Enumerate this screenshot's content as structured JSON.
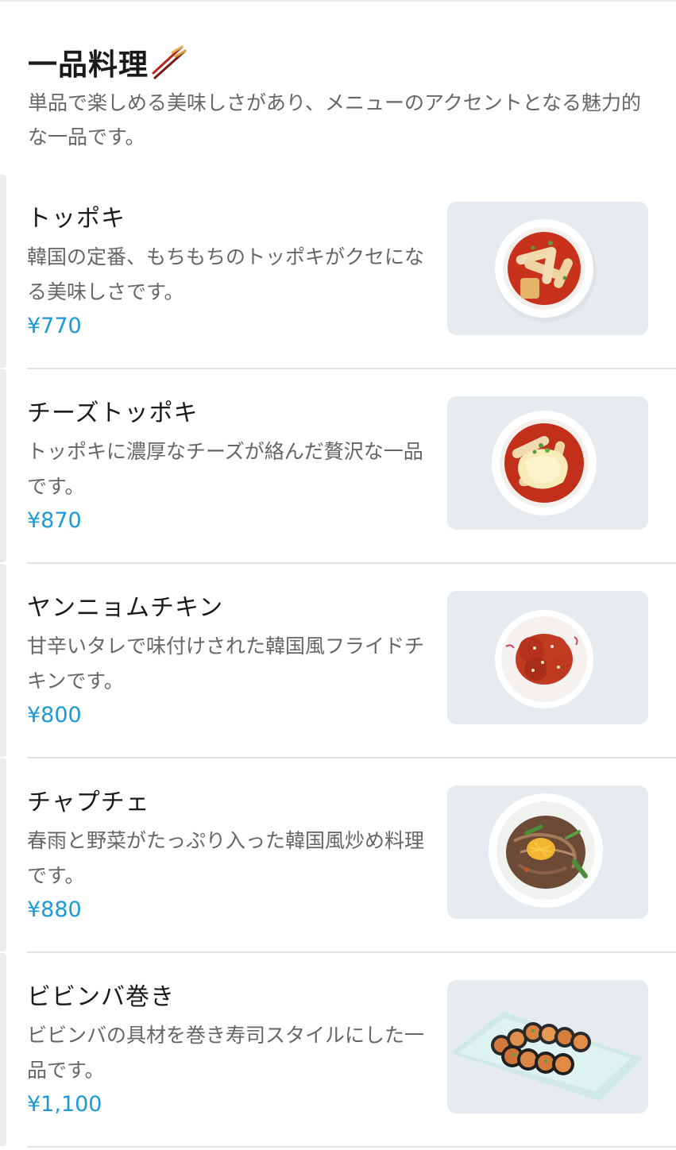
{
  "section": {
    "title": "一品料理",
    "description": "単品で楽しめる美味しさがあり、メニューのアクセントとなる魅力的な一品です。"
  },
  "colors": {
    "price": "#1a9ad6",
    "description": "#666666",
    "divider": "#e3e3e3"
  },
  "items": [
    {
      "name": "トッポキ",
      "description": "韓国の定番、もちもちのトッポキがクセになる美味しさです。",
      "price": "¥770",
      "image_icon": "tteokbokki-photo"
    },
    {
      "name": "チーズトッポキ",
      "description": "トッポキに濃厚なチーズが絡んだ贅沢な一品です。",
      "price": "¥870",
      "image_icon": "cheese-tteokbokki-photo"
    },
    {
      "name": "ヤンニョムチキン",
      "description": "甘辛いタレで味付けされた韓国風フライドチキンです。",
      "price": "¥800",
      "image_icon": "yangnyeom-chicken-photo"
    },
    {
      "name": "チャプチェ",
      "description": "春雨と野菜がたっぷり入った韓国風炒め料理です。",
      "price": "¥880",
      "image_icon": "japchae-photo"
    },
    {
      "name": "ビビンバ巻き",
      "description": "ビビンバの具材を巻き寿司スタイルにした一品です。",
      "price": "¥1,100",
      "image_icon": "bibimbap-roll-photo"
    }
  ]
}
